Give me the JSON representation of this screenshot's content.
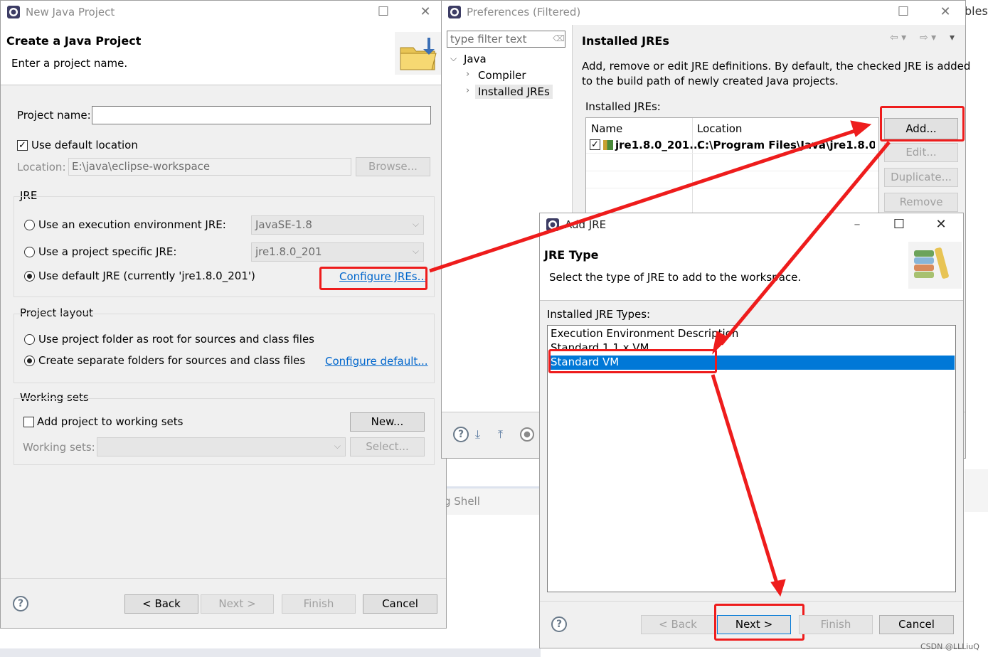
{
  "window1": {
    "title": "New Java Project",
    "header_title": "Create a Java Project",
    "header_desc": "Enter a project name.",
    "project_name_label": "Project name:",
    "project_name_value": "",
    "use_default_location": "Use default location",
    "location_label": "Location:",
    "location_value": "E:\\java\\eclipse-workspace",
    "browse": "Browse...",
    "jre_group": "JRE",
    "jre_option_env": "Use an execution environment JRE:",
    "jre_option_env_value": "JavaSE-1.8",
    "jre_option_specific": "Use a project specific JRE:",
    "jre_option_specific_value": "jre1.8.0_201",
    "jre_option_default": "Use default JRE (currently 'jre1.8.0_201')",
    "configure_jres": "Configure JREs...",
    "layout_group": "Project layout",
    "layout_option_root": "Use project folder as root for sources and class files",
    "layout_option_separate": "Create separate folders for sources and class files",
    "configure_default": "Configure default...",
    "working_sets_group": "Working sets",
    "add_to_working_sets": "Add project to working sets",
    "new_button": "New...",
    "working_sets_label": "Working sets:",
    "select_button": "Select...",
    "back": "< Back",
    "next": "Next >",
    "finish": "Finish",
    "cancel": "Cancel"
  },
  "window2": {
    "title": "Preferences (Filtered)",
    "filter_placeholder": "type filter text",
    "tree": [
      "Java",
      "Compiler",
      "Installed JREs"
    ],
    "page_title": "Installed JREs",
    "desc_line1": "Add, remove or edit JRE definitions. By default, the checked JRE is added",
    "desc_line2": "to the build path of newly created Java projects.",
    "installed_label": "Installed JREs:",
    "col_name": "Name",
    "col_location": "Location",
    "row_name": "jre1.8.0_201...",
    "row_location": "C:\\Program Files\\Java\\jre1.8.0_...",
    "add": "Add...",
    "edit": "Edit...",
    "duplicate": "Duplicate...",
    "remove": "Remove"
  },
  "window3": {
    "title": "Add JRE",
    "header_title": "JRE Type",
    "header_desc": "Select the type of JRE to add to the workspace.",
    "types_label": "Installed JRE Types:",
    "types": [
      "Execution Environment Description",
      "Standard 1.1.x VM",
      "Standard VM"
    ],
    "selected_index": 2,
    "back": "< Back",
    "next": "Next >",
    "finish": "Finish",
    "cancel": "Cancel"
  },
  "background": {
    "partial_right_title": "bles",
    "shell_text": "g Shell",
    "watermark": "CSDN @LLLiuQ"
  },
  "colors": {
    "selection": "#0078d7",
    "annotation_red": "#ee1c1c",
    "link": "#0066cc"
  }
}
